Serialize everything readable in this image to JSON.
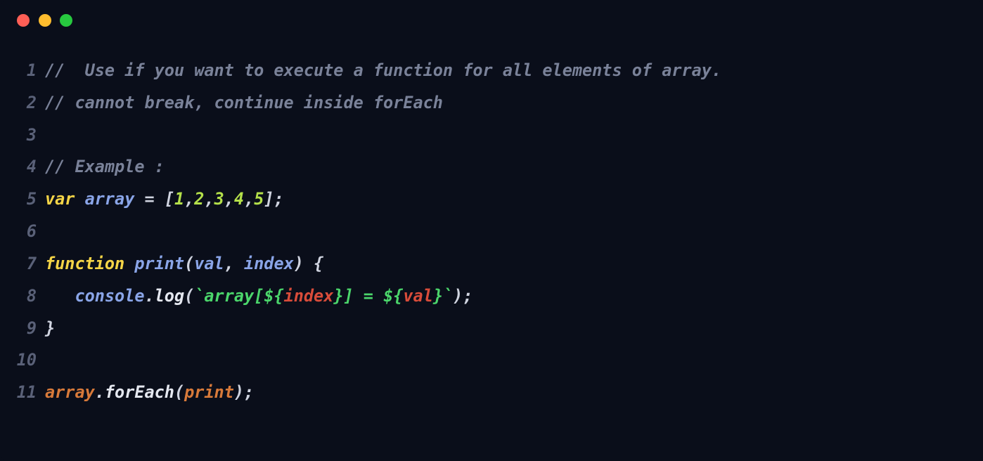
{
  "window": {
    "traffic_lights": [
      "close",
      "minimize",
      "zoom"
    ]
  },
  "code": {
    "lines": [
      {
        "num": "1",
        "tokens": [
          {
            "cls": "tok-comment",
            "text": "//  Use if you want to execute a function for all elements of array."
          }
        ]
      },
      {
        "num": "2",
        "tokens": [
          {
            "cls": "tok-comment",
            "text": "// cannot break, continue inside forEach"
          }
        ]
      },
      {
        "num": "3",
        "tokens": []
      },
      {
        "num": "4",
        "tokens": [
          {
            "cls": "tok-comment",
            "text": "// Example :"
          }
        ]
      },
      {
        "num": "5",
        "tokens": [
          {
            "cls": "tok-keyword",
            "text": "var"
          },
          {
            "cls": "tok-white",
            "text": " "
          },
          {
            "cls": "tok-varname",
            "text": "array"
          },
          {
            "cls": "tok-white",
            "text": " "
          },
          {
            "cls": "tok-op",
            "text": "="
          },
          {
            "cls": "tok-white",
            "text": " "
          },
          {
            "cls": "tok-punct",
            "text": "["
          },
          {
            "cls": "tok-number",
            "text": "1"
          },
          {
            "cls": "tok-punct",
            "text": ","
          },
          {
            "cls": "tok-number",
            "text": "2"
          },
          {
            "cls": "tok-punct",
            "text": ","
          },
          {
            "cls": "tok-number",
            "text": "3"
          },
          {
            "cls": "tok-punct",
            "text": ","
          },
          {
            "cls": "tok-number",
            "text": "4"
          },
          {
            "cls": "tok-punct",
            "text": ","
          },
          {
            "cls": "tok-number",
            "text": "5"
          },
          {
            "cls": "tok-punct",
            "text": "];"
          }
        ]
      },
      {
        "num": "6",
        "tokens": []
      },
      {
        "num": "7",
        "tokens": [
          {
            "cls": "tok-keyword",
            "text": "function"
          },
          {
            "cls": "tok-white",
            "text": " "
          },
          {
            "cls": "tok-varname",
            "text": "print"
          },
          {
            "cls": "tok-punct",
            "text": "("
          },
          {
            "cls": "tok-varname",
            "text": "val"
          },
          {
            "cls": "tok-punct",
            "text": ", "
          },
          {
            "cls": "tok-varname",
            "text": "index"
          },
          {
            "cls": "tok-punct",
            "text": ")"
          },
          {
            "cls": "tok-white",
            "text": " "
          },
          {
            "cls": "tok-punct",
            "text": "{"
          }
        ]
      },
      {
        "num": "8",
        "tokens": [
          {
            "cls": "tok-white",
            "text": "   "
          },
          {
            "cls": "tok-varname",
            "text": "console"
          },
          {
            "cls": "tok-punct",
            "text": "."
          },
          {
            "cls": "tok-func",
            "text": "log"
          },
          {
            "cls": "tok-punct",
            "text": "("
          },
          {
            "cls": "tok-string",
            "text": "`array["
          },
          {
            "cls": "tok-interp-delim",
            "text": "${"
          },
          {
            "cls": "tok-interp-var",
            "text": "index"
          },
          {
            "cls": "tok-interp-delim",
            "text": "}"
          },
          {
            "cls": "tok-string",
            "text": "] = "
          },
          {
            "cls": "tok-interp-delim",
            "text": "${"
          },
          {
            "cls": "tok-interp-var",
            "text": "val"
          },
          {
            "cls": "tok-interp-delim",
            "text": "}"
          },
          {
            "cls": "tok-string",
            "text": "`"
          },
          {
            "cls": "tok-punct",
            "text": ");"
          }
        ]
      },
      {
        "num": "9",
        "tokens": [
          {
            "cls": "tok-punct",
            "text": "}"
          }
        ]
      },
      {
        "num": "10",
        "tokens": []
      },
      {
        "num": "11",
        "tokens": [
          {
            "cls": "tok-call",
            "text": "array"
          },
          {
            "cls": "tok-punct",
            "text": "."
          },
          {
            "cls": "tok-func",
            "text": "forEach"
          },
          {
            "cls": "tok-punct",
            "text": "("
          },
          {
            "cls": "tok-call",
            "text": "print"
          },
          {
            "cls": "tok-punct",
            "text": ");"
          }
        ]
      }
    ]
  }
}
